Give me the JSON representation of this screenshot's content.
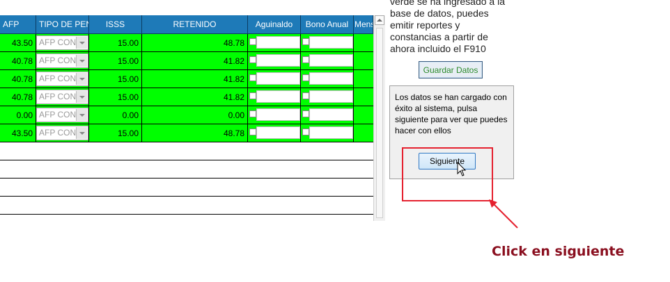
{
  "grid": {
    "columns": [
      "AFP",
      "TIPO DE PEN",
      "ISSS",
      "RETENIDO",
      "Aguinaldo",
      "Bono Anual",
      "Mens"
    ],
    "combo_value": "AFP CON",
    "rows": [
      {
        "afp": "43.50",
        "isss": "15.00",
        "retenido": "48.78"
      },
      {
        "afp": "40.78",
        "isss": "15.00",
        "retenido": "41.82"
      },
      {
        "afp": "40.78",
        "isss": "15.00",
        "retenido": "41.82"
      },
      {
        "afp": "40.78",
        "isss": "15.00",
        "retenido": "41.82"
      },
      {
        "afp": "0.00",
        "isss": "0.00",
        "retenido": "0.00"
      },
      {
        "afp": "43.50",
        "isss": "15.00",
        "retenido": "48.78"
      }
    ],
    "row_color": "#00ff00",
    "header_color": "#1e7ab8"
  },
  "info": {
    "lines": [
      "verde se ha ingresado a la",
      "base de datos, puedes",
      "emitir reportes y",
      "constancias a partir de",
      "ahora incluido el F910"
    ]
  },
  "save_button": "Guardar Datos",
  "message": {
    "text": "Los datos se han cargado con éxito al sistema, pulsa siguiente para ver que puedes hacer con ellos"
  },
  "next_button": "Siguiente",
  "annotation": {
    "text": "Click en siguiente",
    "color": "#8a0f1f",
    "highlight_color": "#e5202e"
  }
}
